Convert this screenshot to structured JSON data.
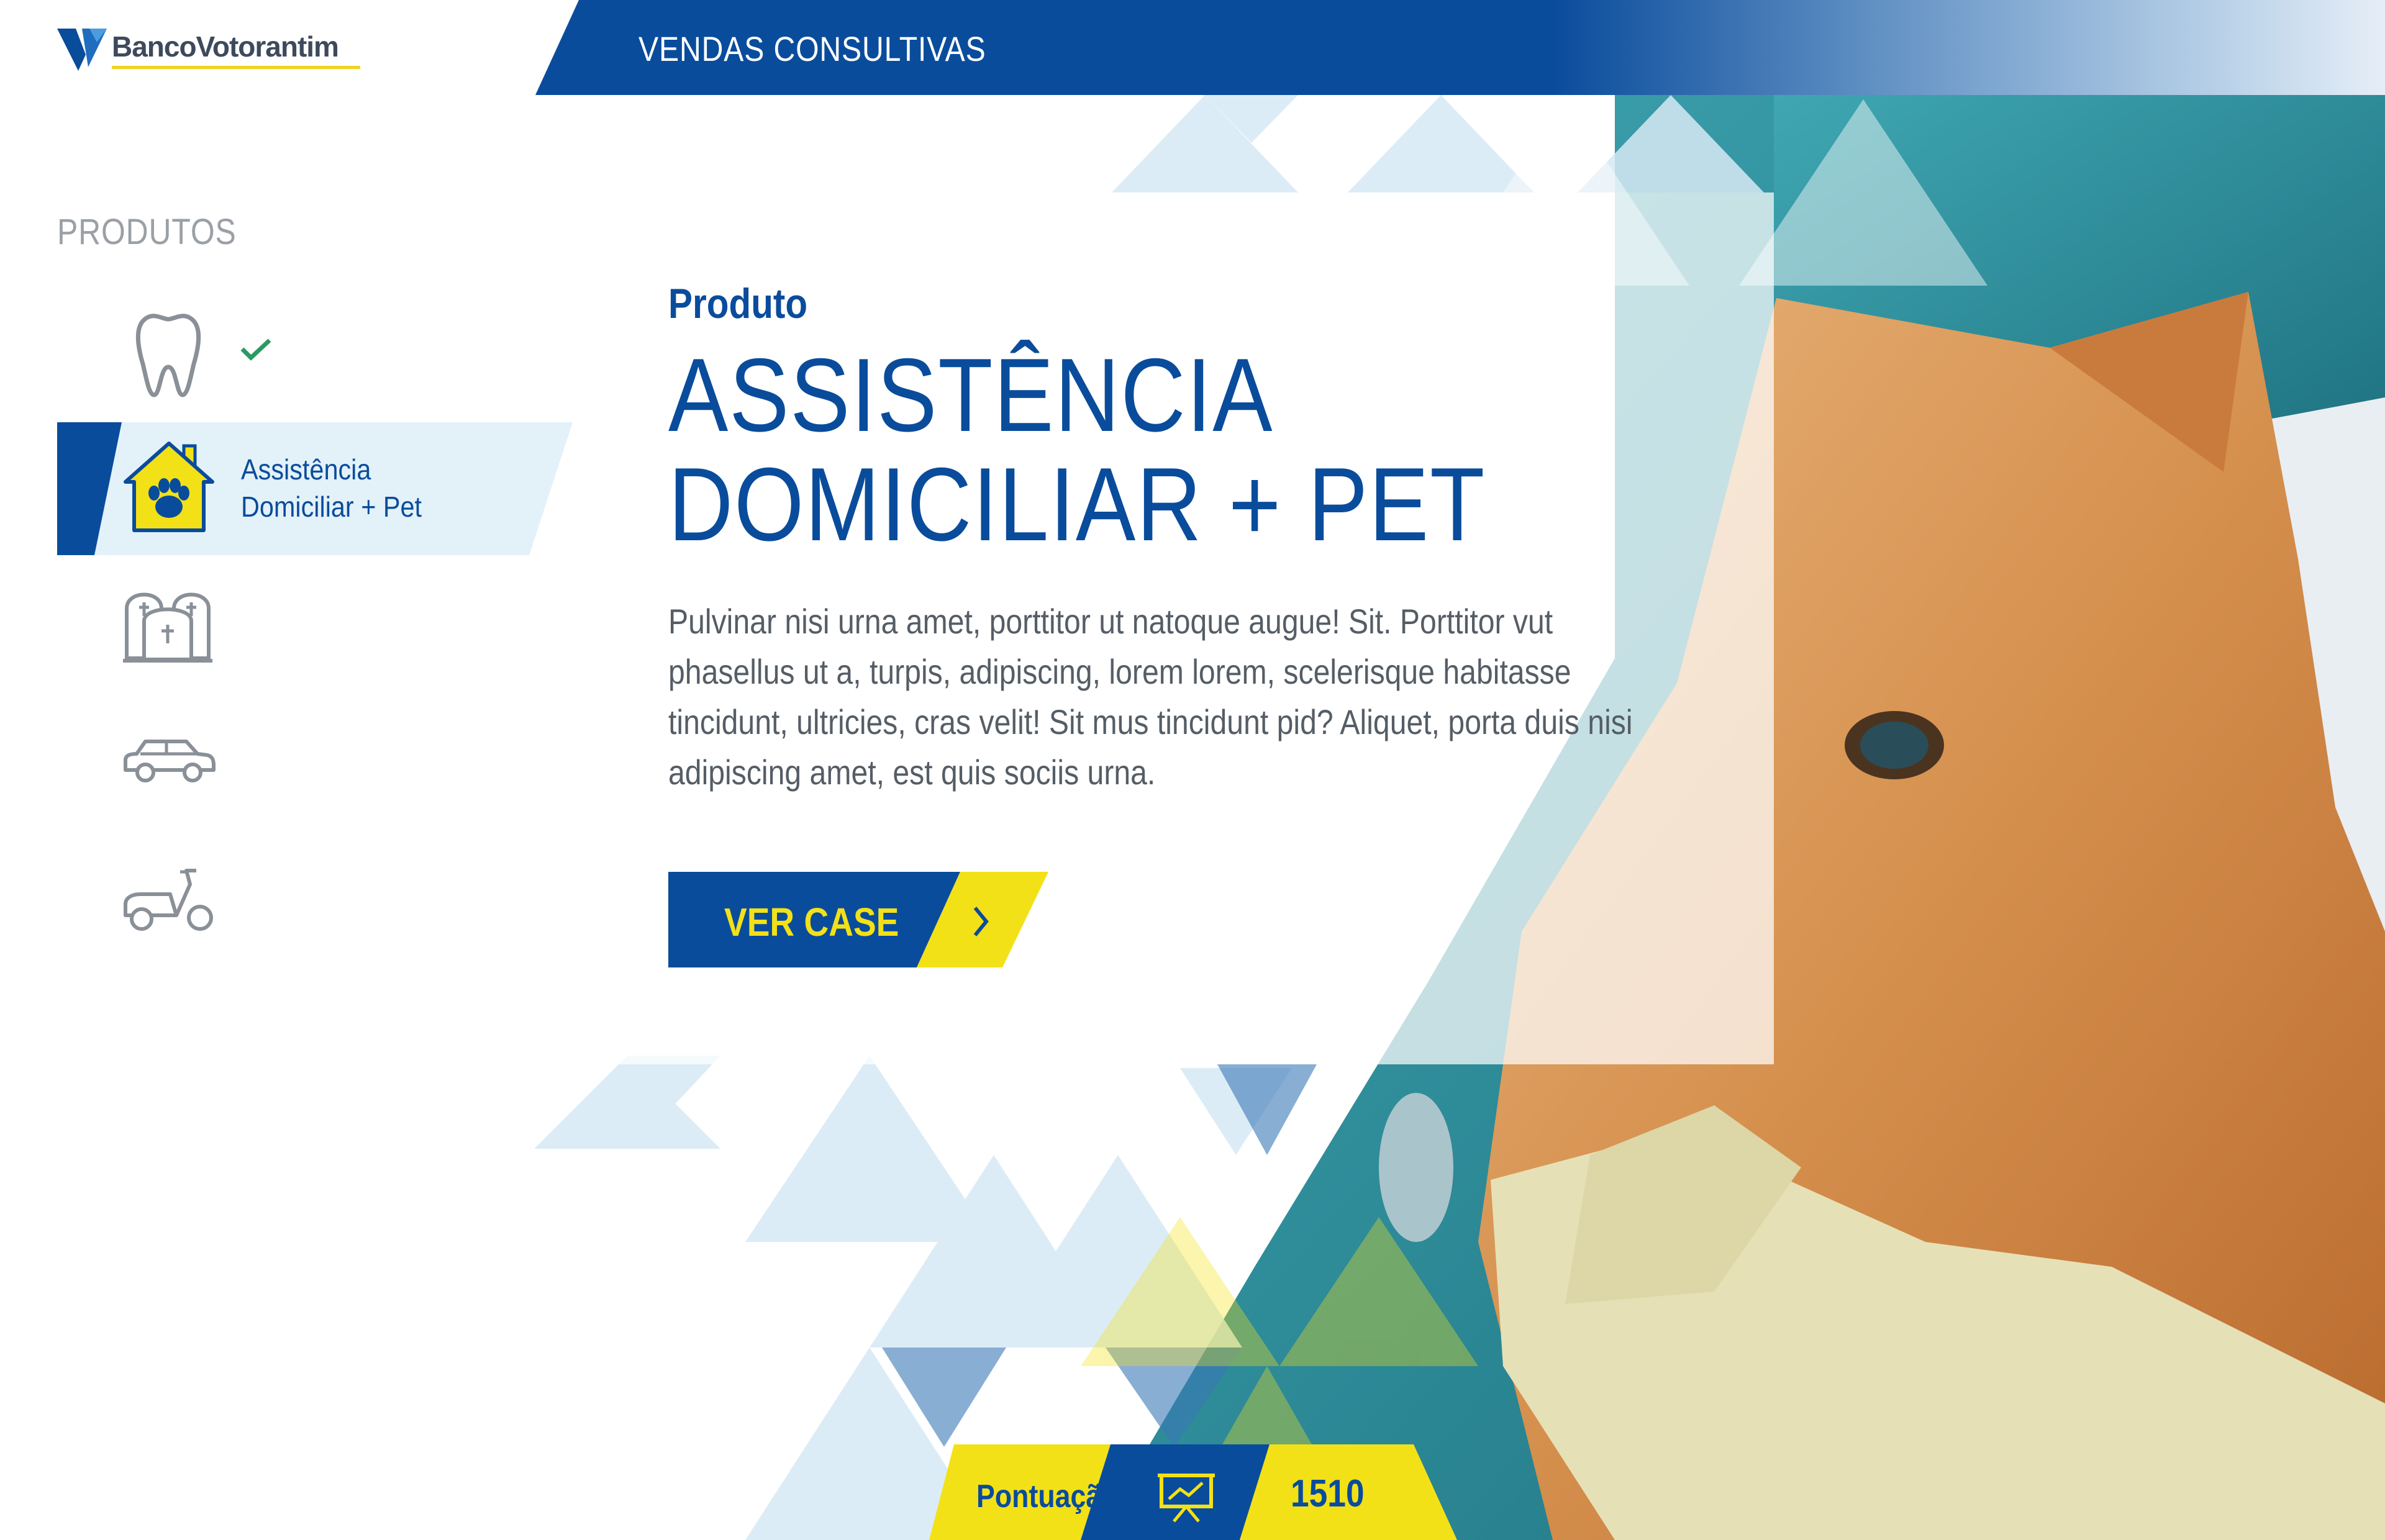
{
  "brand": {
    "name": "BancoVotorantim",
    "colors": {
      "primary": "#0a4c9c",
      "accent": "#f3e117",
      "light": "#e3f1f9"
    }
  },
  "header": {
    "title": "VENDAS CONSULTIVAS"
  },
  "sidebar": {
    "heading": "PRODUTOS",
    "items": [
      {
        "icon": "tooth-icon",
        "status": "completed"
      },
      {
        "icon": "house-paw-icon",
        "label": "Assistência\nDomiciliar + Pet",
        "status": "active"
      },
      {
        "icon": "tombstones-icon"
      },
      {
        "icon": "car-icon"
      },
      {
        "icon": "scooter-icon"
      }
    ]
  },
  "product": {
    "label": "Produto",
    "title_line1": "ASSISTÊNCIA",
    "title_line2": "DOMICILIAR + PET",
    "description": "Pulvinar nisi urna amet, porttitor ut natoque augue! Sit. Porttitor vut phasellus ut a, turpis, adipiscing, lorem lorem, scelerisque habitasse tincidunt, ultricies, cras velit! Sit mus tincidunt pid? Aliquet, porta duis nisi adipiscing amet, est quis sociis urna.",
    "cta_label": "VER CASE"
  },
  "score": {
    "label": "Pontuação",
    "value": "1510",
    "icon": "presentation-board-icon"
  }
}
